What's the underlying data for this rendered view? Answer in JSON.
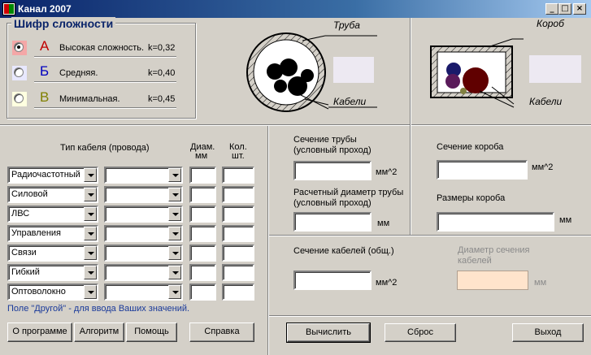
{
  "window": {
    "title": "Канал 2007",
    "minimize": "_",
    "maximize": "□",
    "close": "×"
  },
  "complexity": {
    "title": "Шифр сложности",
    "options": [
      {
        "letter": "А",
        "label": "Высокая сложность.",
        "k": "k=0,32",
        "selected": true,
        "color": "#f4a7a7",
        "letter_color": "#c00000"
      },
      {
        "letter": "Б",
        "label": "Средняя.",
        "k": "k=0,40",
        "selected": false,
        "color": "#e8e8ff",
        "letter_color": "#0000c0"
      },
      {
        "letter": "В",
        "label": "Минимальная.",
        "k": "k=0,45",
        "selected": false,
        "color": "#ffffe0",
        "letter_color": "#808000"
      }
    ]
  },
  "pipe_diagram": {
    "pipe_label": "Труба",
    "cables_label": "Кабели"
  },
  "box_diagram": {
    "box_label": "Короб",
    "cables_label": "Кабели"
  },
  "cable_table": {
    "type_header": "Тип кабеля (провода)",
    "diam_header_1": "Диам.",
    "diam_header_2": "мм",
    "count_header_1": "Кол.",
    "count_header_2": "шт.",
    "rows": [
      {
        "type": "Радиочастотный",
        "subtype": "",
        "diam": "",
        "count": ""
      },
      {
        "type": "Силовой",
        "subtype": "",
        "diam": "",
        "count": ""
      },
      {
        "type": "ЛВС",
        "subtype": "",
        "diam": "",
        "count": ""
      },
      {
        "type": "Управления",
        "subtype": "",
        "diam": "",
        "count": ""
      },
      {
        "type": "Связи",
        "subtype": "",
        "diam": "",
        "count": ""
      },
      {
        "type": "Гибкий",
        "subtype": "",
        "diam": "",
        "count": ""
      },
      {
        "type": "Оптоволокно",
        "subtype": "",
        "diam": "",
        "count": ""
      }
    ],
    "hint": "Поле \"Другой\" - для ввода Ваших значений."
  },
  "pipe_results": {
    "section_label_1": "Сечение трубы",
    "section_label_2": "(условный проход)",
    "section_value": "",
    "section_unit": "мм^2",
    "diameter_label_1": "Расчетный диаметр трубы",
    "diameter_label_2": "(условный проход)",
    "diameter_value": "",
    "diameter_unit": "мм"
  },
  "box_results": {
    "section_label": "Сечение короба",
    "section_value": "",
    "section_unit": "мм^2",
    "size_label": "Размеры короба",
    "size_value": "",
    "size_unit": "мм"
  },
  "cables_results": {
    "section_label": "Сечение кабелей (общ.)",
    "section_value": "",
    "section_unit": "мм^2",
    "diameter_label_1": "Диаметр сечения",
    "diameter_label_2": "кабелей",
    "diameter_value": "",
    "diameter_unit": "мм",
    "diameter_field_color": "#ffe4cc"
  },
  "buttons": {
    "about": "О программе",
    "algorithm": "Алгоритм",
    "help": "Помощь",
    "reference": "Справка",
    "calculate": "Вычислить",
    "reset": "Сброс",
    "exit": "Выход"
  }
}
